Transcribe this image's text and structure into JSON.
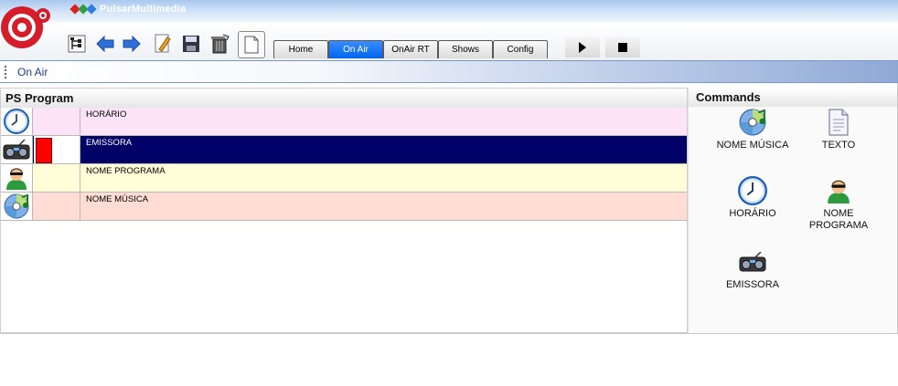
{
  "brand": {
    "name_prefix": "Pulsar",
    "name_suffix": "Multimedia",
    "diamond_colors": [
      "#e02020",
      "#2fa040",
      "#2f7fe0"
    ]
  },
  "toolbar": {
    "icons": [
      "sitemap-icon",
      "back-arrow-icon",
      "forward-arrow-icon",
      "pencil-icon",
      "save-icon",
      "trash-icon",
      "new-document-icon"
    ],
    "tabs": [
      {
        "label": "Home",
        "active": false
      },
      {
        "label": "On Air",
        "active": true
      },
      {
        "label": "OnAir RT",
        "active": false
      },
      {
        "label": "Shows",
        "active": false
      },
      {
        "label": "Config",
        "active": false
      }
    ],
    "player": {
      "play": "play-icon",
      "stop": "stop-icon"
    }
  },
  "breadcrumb": {
    "label": "On Air"
  },
  "ps_program": {
    "title": "PS Program",
    "rows": [
      {
        "label": "HORÁRIO",
        "icon": "clock-icon",
        "bg": "#fde3f8",
        "text_color": "#000000",
        "swatch": ""
      },
      {
        "label": "EMISSORA",
        "icon": "radio-icon",
        "bg": "#000066",
        "text_color": "#ffffff",
        "swatch": "#ff0000"
      },
      {
        "label": "NOME PROGRAMA",
        "icon": "person-icon",
        "bg": "#fffed8",
        "text_color": "#000000",
        "swatch": ""
      },
      {
        "label": "NOME MÚSICA",
        "icon": "cd-icon",
        "bg": "#ffdcd4",
        "text_color": "#000000",
        "swatch": ""
      }
    ]
  },
  "commands": {
    "title": "Commands",
    "items": [
      {
        "label": "NOME MÚSICA",
        "icon": "cd-icon"
      },
      {
        "label": "TEXTO",
        "icon": "document-icon"
      },
      {
        "label": "HORÁRIO",
        "icon": "clock-icon"
      },
      {
        "label": "NOME PROGRAMA",
        "icon": "person-icon"
      },
      {
        "label": "EMISSORA",
        "icon": "radio-icon"
      }
    ]
  }
}
